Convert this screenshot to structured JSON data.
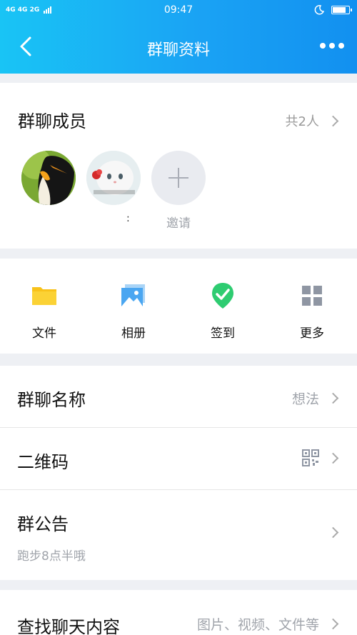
{
  "status_bar": {
    "network": "4G 4G 2G",
    "time": "09:47",
    "battery_level": 0.9
  },
  "header": {
    "title": "群聊资料"
  },
  "members": {
    "title": "群聊成员",
    "count": "共2人",
    "member_name": ":",
    "invite_label": "邀请"
  },
  "tools": [
    {
      "label": "文件",
      "icon": "folder-icon"
    },
    {
      "label": "相册",
      "icon": "photo-album-icon"
    },
    {
      "label": "签到",
      "icon": "check-in-icon"
    },
    {
      "label": "更多",
      "icon": "grid-more-icon"
    }
  ],
  "settings": {
    "group_name": {
      "label": "群聊名称",
      "value": "想法"
    },
    "qrcode": {
      "label": "二维码",
      "icon": "qr-code-icon"
    },
    "notice": {
      "label": "群公告",
      "value": "跑步8点半哦"
    },
    "search": {
      "label": "查找聊天内容",
      "value": "图片、视频、文件等"
    }
  },
  "colors": {
    "header_start": "#19c4f5",
    "header_end": "#1290f0",
    "checkin_green": "#2ecc71",
    "folder_yellow": "#f8c21a"
  }
}
